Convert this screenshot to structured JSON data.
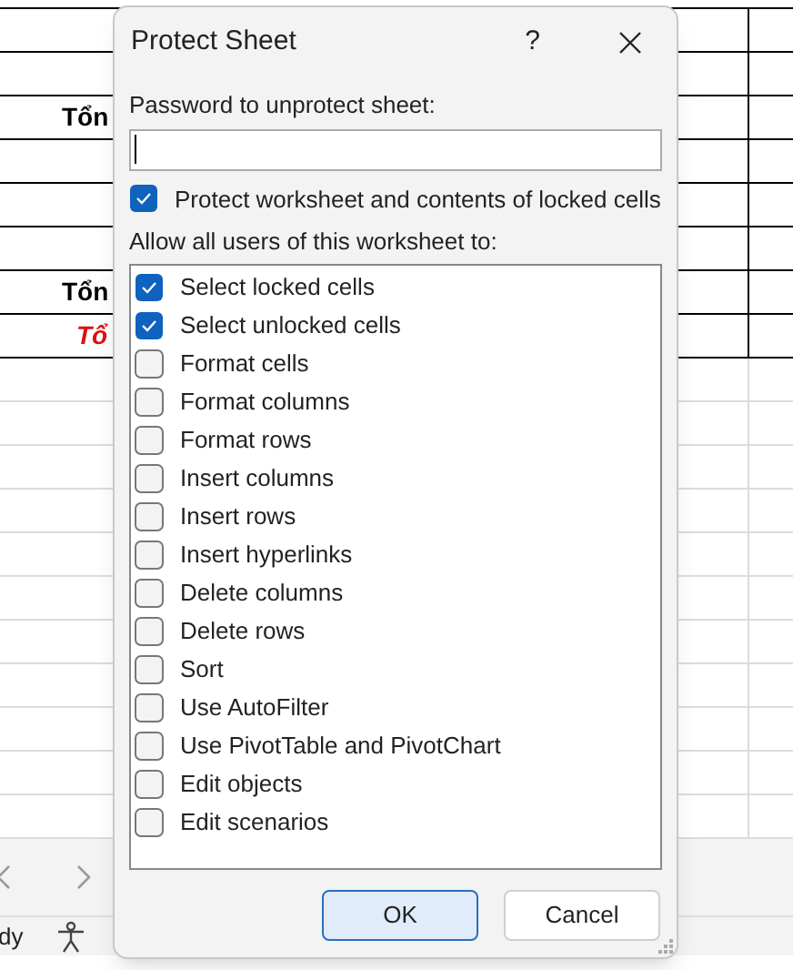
{
  "sheet": {
    "labels": [
      {
        "text": "Tổn",
        "kind": "bold"
      },
      {
        "text": "Tổn",
        "kind": "bold"
      },
      {
        "text": "Tổ",
        "kind": "red"
      }
    ]
  },
  "status_bar": {
    "mode": "dy"
  },
  "dialog": {
    "title": "Protect Sheet",
    "help": "?",
    "password": {
      "label": "Password to unprotect sheet:"
    },
    "protect": {
      "label": "Protect worksheet and contents of locked cells",
      "checked": true
    },
    "allow_label": "Allow all users of this worksheet to:",
    "options": [
      {
        "label": "Select locked cells",
        "checked": true
      },
      {
        "label": "Select unlocked cells",
        "checked": true
      },
      {
        "label": "Format cells",
        "checked": false
      },
      {
        "label": "Format columns",
        "checked": false
      },
      {
        "label": "Format rows",
        "checked": false
      },
      {
        "label": "Insert columns",
        "checked": false
      },
      {
        "label": "Insert rows",
        "checked": false
      },
      {
        "label": "Insert hyperlinks",
        "checked": false
      },
      {
        "label": "Delete columns",
        "checked": false
      },
      {
        "label": "Delete rows",
        "checked": false
      },
      {
        "label": "Sort",
        "checked": false
      },
      {
        "label": "Use AutoFilter",
        "checked": false
      },
      {
        "label": "Use PivotTable and PivotChart",
        "checked": false
      },
      {
        "label": "Edit objects",
        "checked": false
      },
      {
        "label": "Edit scenarios",
        "checked": false
      }
    ],
    "buttons": [
      "OK",
      "Cancel"
    ]
  }
}
